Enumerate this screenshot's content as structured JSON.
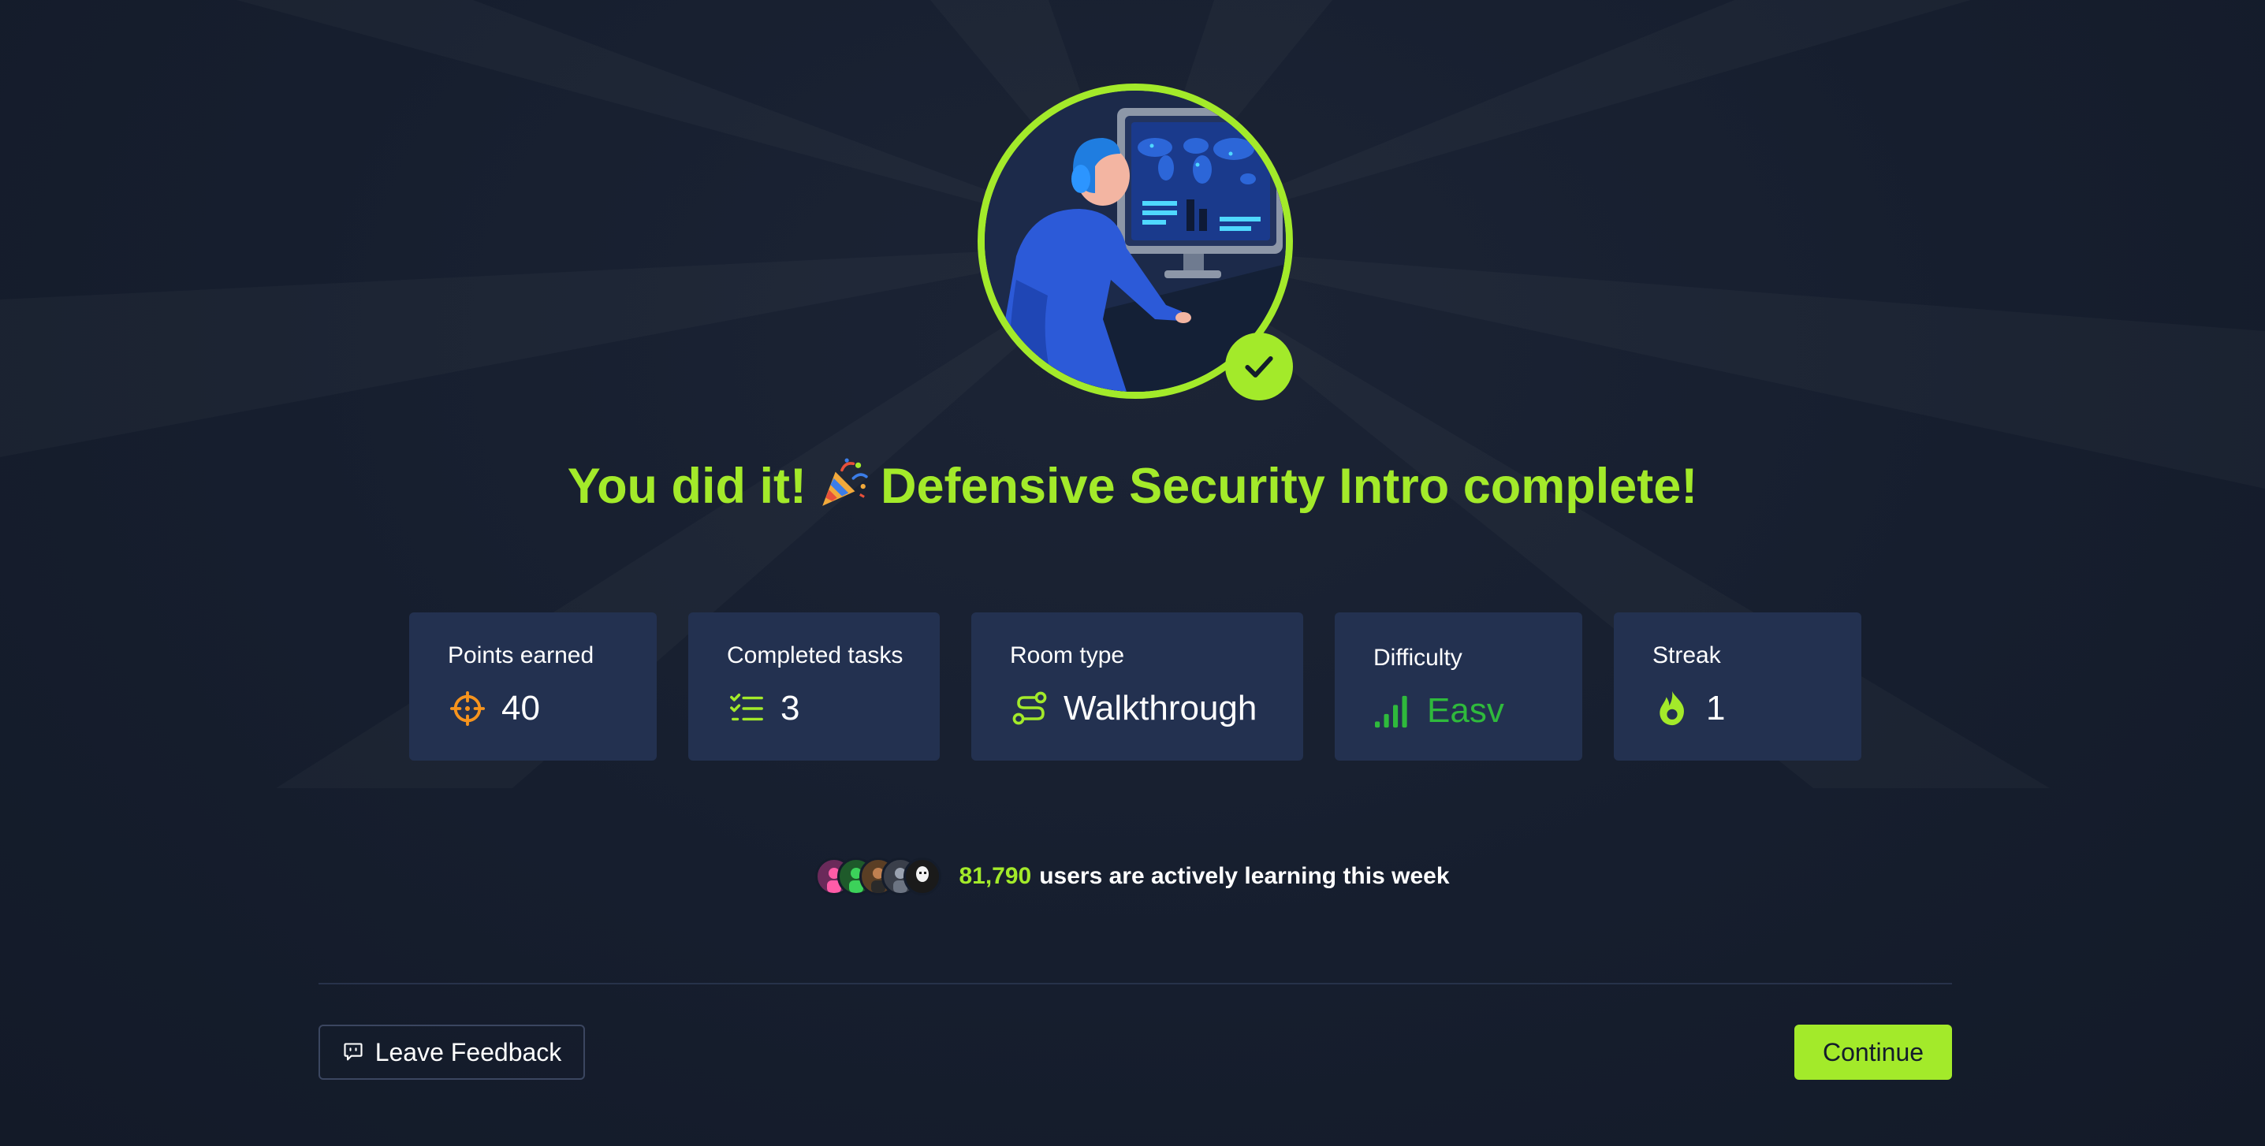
{
  "headline": {
    "prefix": "You did it!",
    "emoji": "party-popper-emoji",
    "suffix": "Defensive Security Intro complete!"
  },
  "stats": [
    {
      "label": "Points earned",
      "value": "40",
      "icon": "target-icon"
    },
    {
      "label": "Completed tasks",
      "value": "3",
      "icon": "checklist-icon"
    },
    {
      "label": "Room type",
      "value": "Walkthrough",
      "icon": "route-icon"
    },
    {
      "label": "Difficulty",
      "value": "Easv",
      "icon": "signal-bars-icon"
    },
    {
      "label": "Streak",
      "value": "1",
      "icon": "flame-icon"
    }
  ],
  "learners": {
    "count": "81,790",
    "text": "users are actively learning this week"
  },
  "actions": {
    "feedback_label": "Leave Feedback",
    "continue_label": "Continue"
  },
  "colors": {
    "accent": "#a3ea2a",
    "background": "#141c2b",
    "card": "#233150",
    "easy": "#2fba3c",
    "points_icon": "#f7941d"
  }
}
